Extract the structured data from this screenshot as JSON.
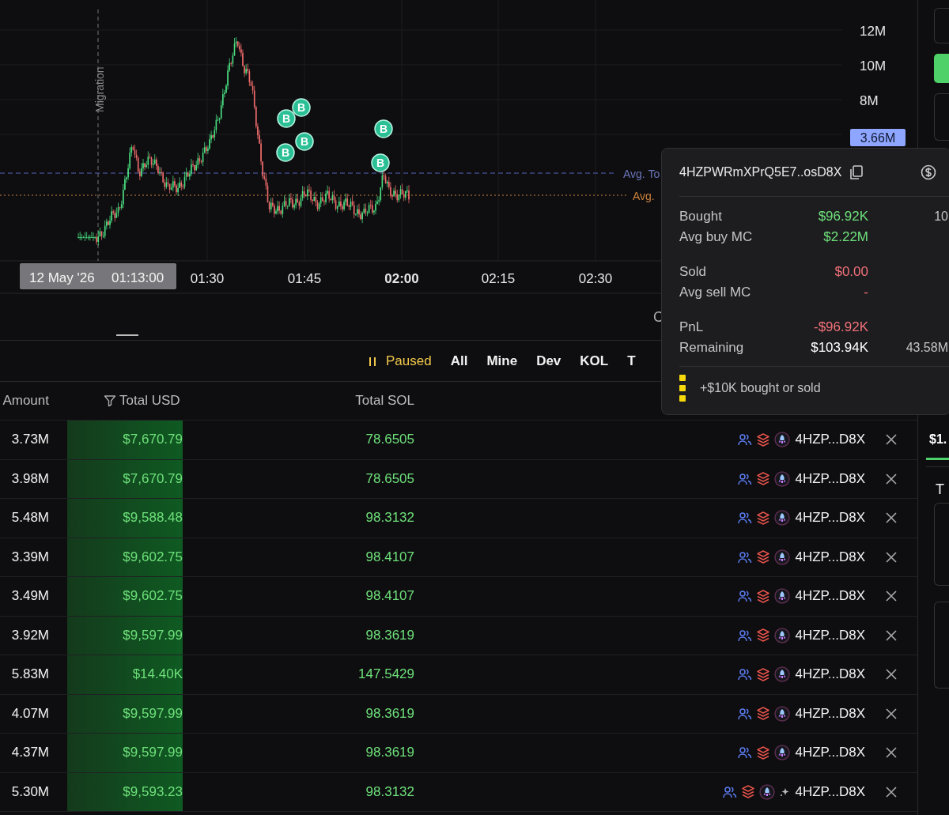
{
  "chart": {
    "y_axis": [
      "12M",
      "10M",
      "8M"
    ],
    "price_label": "3.66M",
    "migration_label": "Migration",
    "avg_lines": [
      {
        "label": "Avg. To",
        "kind": "dashed"
      },
      {
        "label": "Avg.",
        "kind": "dotted"
      }
    ],
    "trade_markers": [
      {
        "label": "B"
      },
      {
        "label": "B"
      },
      {
        "label": "B"
      },
      {
        "label": "B"
      },
      {
        "label": "B"
      },
      {
        "label": "B"
      }
    ],
    "crosshair": {
      "date": "12 May '26",
      "time": "01:13:00"
    },
    "x_axis": [
      {
        "label": "01:30",
        "bold": false
      },
      {
        "label": "01:45",
        "bold": false
      },
      {
        "label": "02:00",
        "bold": true
      },
      {
        "label": "02:15",
        "bold": false
      },
      {
        "label": "02:30",
        "bold": false
      }
    ],
    "cut_label": "C"
  },
  "filters": [
    {
      "label": "Paused",
      "kind": "pause",
      "paused": true
    },
    {
      "label": "All",
      "kind": "tab"
    },
    {
      "label": "Mine",
      "kind": "tab"
    },
    {
      "label": "Dev",
      "kind": "tab"
    },
    {
      "label": "KOL",
      "kind": "tab"
    },
    {
      "label": "T",
      "kind": "tab"
    }
  ],
  "table": {
    "columns": [
      "Amount",
      "Total USD",
      "Total SOL"
    ],
    "rows": [
      {
        "amount": "3.73M",
        "total_usd": "$7,670.79",
        "total_sol": "78.6505",
        "trader": "4HZP...D8X",
        "sparkle": false
      },
      {
        "amount": "3.98M",
        "total_usd": "$7,670.79",
        "total_sol": "78.6505",
        "trader": "4HZP...D8X",
        "sparkle": false
      },
      {
        "amount": "5.48M",
        "total_usd": "$9,588.48",
        "total_sol": "98.3132",
        "trader": "4HZP...D8X",
        "sparkle": false
      },
      {
        "amount": "3.39M",
        "total_usd": "$9,602.75",
        "total_sol": "98.4107",
        "trader": "4HZP...D8X",
        "sparkle": false
      },
      {
        "amount": "3.49M",
        "total_usd": "$9,602.75",
        "total_sol": "98.4107",
        "trader": "4HZP...D8X",
        "sparkle": false
      },
      {
        "amount": "3.92M",
        "total_usd": "$9,597.99",
        "total_sol": "98.3619",
        "trader": "4HZP...D8X",
        "sparkle": false
      },
      {
        "amount": "5.83M",
        "total_usd": "$14.40K",
        "total_sol": "147.5429",
        "trader": "4HZP...D8X",
        "sparkle": false
      },
      {
        "amount": "4.07M",
        "total_usd": "$9,597.99",
        "total_sol": "98.3619",
        "trader": "4HZP...D8X",
        "sparkle": false
      },
      {
        "amount": "4.37M",
        "total_usd": "$9,597.99",
        "total_sol": "98.3619",
        "trader": "4HZP...D8X",
        "sparkle": false
      },
      {
        "amount": "5.30M",
        "total_usd": "$9,593.23",
        "total_sol": "98.3132",
        "trader": "4HZP...D8X",
        "sparkle": true
      }
    ]
  },
  "tooltip": {
    "address": "4HZPWRmXPrQ5E7..osD8X",
    "groups": [
      [
        {
          "label": "Bought",
          "value": "$96.92K",
          "color": "#6ee07a",
          "extra": "10"
        },
        {
          "label": "Avg buy MC",
          "value": "$2.22M",
          "color": "#6ee07a"
        }
      ],
      [
        {
          "label": "Sold",
          "value": "$0.00",
          "color": "#f07178"
        },
        {
          "label": "Avg sell MC",
          "value": "-",
          "color": "#f07178"
        }
      ],
      [
        {
          "label": "PnL",
          "value": "-$96.92K",
          "color": "#f07178"
        },
        {
          "label": "Remaining",
          "value": "$103.94K",
          "color": "#ffffff",
          "extra": "43.58M"
        }
      ]
    ],
    "legend": "+$10K bought or sold"
  },
  "sidebar": {
    "tab": {
      "label": "$1.",
      "selected": true
    },
    "heading": "T"
  }
}
